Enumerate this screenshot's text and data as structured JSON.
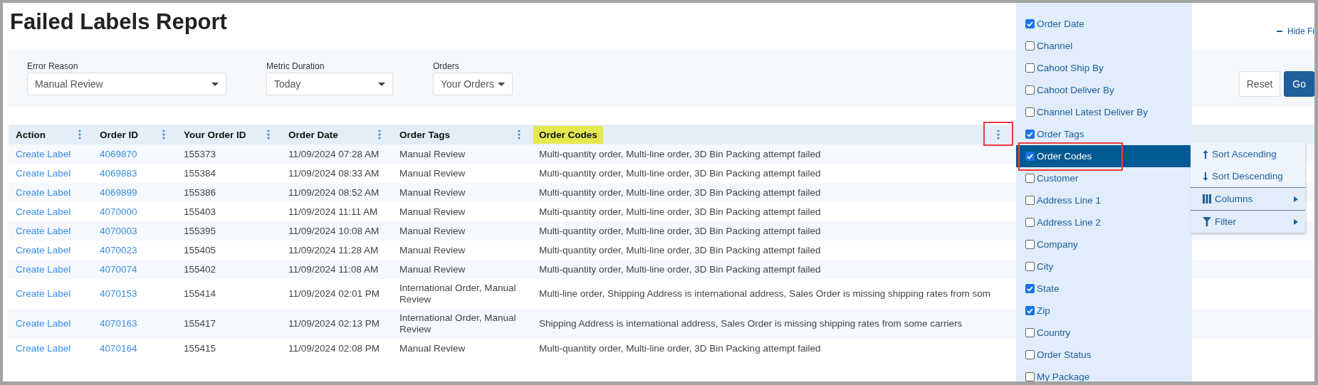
{
  "page": {
    "title": "Failed Labels Report",
    "hide_filters_link": "Hide Fi"
  },
  "filters": [
    {
      "label": "Error Reason",
      "value": "Manual Review"
    },
    {
      "label": "Metric Duration",
      "value": "Today"
    },
    {
      "label": "Orders",
      "value": "Your Orders"
    }
  ],
  "filter_buttons": [
    {
      "label": "Reset",
      "kind": "secondary"
    },
    {
      "label": "Go",
      "kind": "primary"
    }
  ],
  "table": {
    "columns": [
      {
        "label": "Action",
        "highlighted": false,
        "menu_outlined": false
      },
      {
        "label": "Order ID",
        "highlighted": false,
        "menu_outlined": false
      },
      {
        "label": "Your Order ID",
        "highlighted": false,
        "menu_outlined": false
      },
      {
        "label": "Order Date",
        "highlighted": false,
        "menu_outlined": false
      },
      {
        "label": "Order Tags",
        "highlighted": false,
        "menu_outlined": false
      },
      {
        "label": "Order Codes",
        "highlighted": true,
        "menu_outlined": true
      }
    ],
    "rows": [
      [
        "Create Label",
        "4069870",
        "155373",
        "11/09/2024 07:28 AM",
        "Manual Review",
        "Multi-quantity order, Multi-line order, 3D Bin Packing attempt failed"
      ],
      [
        "Create Label",
        "4069883",
        "155384",
        "11/09/2024 08:33 AM",
        "Manual Review",
        "Multi-quantity order, Multi-line order, 3D Bin Packing attempt failed"
      ],
      [
        "Create Label",
        "4069899",
        "155386",
        "11/09/2024 08:52 AM",
        "Manual Review",
        "Multi-quantity order, Multi-line order, 3D Bin Packing attempt failed"
      ],
      [
        "Create Label",
        "4070000",
        "155403",
        "11/09/2024 11:11 AM",
        "Manual Review",
        "Multi-quantity order, Multi-line order, 3D Bin Packing attempt failed"
      ],
      [
        "Create Label",
        "4070003",
        "155395",
        "11/09/2024 10:08 AM",
        "Manual Review",
        "Multi-quantity order, Multi-line order, 3D Bin Packing attempt failed"
      ],
      [
        "Create Label",
        "4070023",
        "155405",
        "11/09/2024 11:28 AM",
        "Manual Review",
        "Multi-quantity order, Multi-line order, 3D Bin Packing attempt failed"
      ],
      [
        "Create Label",
        "4070074",
        "155402",
        "11/09/2024 11:08 AM",
        "Manual Review",
        "Multi-quantity order, Multi-line order, 3D Bin Packing attempt failed"
      ],
      [
        "Create Label",
        "4070153",
        "155414",
        "11/09/2024 02:01 PM",
        "International Order, Manual Review",
        "Multi-line order, Shipping Address is international address, Sales Order is missing shipping rates from som"
      ],
      [
        "Create Label",
        "4070163",
        "155417",
        "11/09/2024 02:13 PM",
        "International Order, Manual Review",
        "Shipping Address is international address, Sales Order is missing shipping rates from some carriers"
      ],
      [
        "Create Label",
        "4070164",
        "155415",
        "11/09/2024 02:08 PM",
        "Manual Review",
        "Multi-quantity order, Multi-line order, 3D Bin Packing attempt failed"
      ]
    ]
  },
  "columns_menu": {
    "items": [
      {
        "label": "Order Date",
        "checked": true,
        "selected": false,
        "outlined": false
      },
      {
        "label": "Channel",
        "checked": false,
        "selected": false,
        "outlined": false
      },
      {
        "label": "Cahoot Ship By",
        "checked": false,
        "selected": false,
        "outlined": false
      },
      {
        "label": "Cahoot Deliver By",
        "checked": false,
        "selected": false,
        "outlined": false
      },
      {
        "label": "Channel Latest Deliver By",
        "checked": false,
        "selected": false,
        "outlined": false
      },
      {
        "label": "Order Tags",
        "checked": true,
        "selected": false,
        "outlined": false
      },
      {
        "label": "Order Codes",
        "checked": true,
        "selected": true,
        "outlined": true
      },
      {
        "label": "Customer",
        "checked": false,
        "selected": false,
        "outlined": false
      },
      {
        "label": "Address Line 1",
        "checked": false,
        "selected": false,
        "outlined": false
      },
      {
        "label": "Address Line 2",
        "checked": false,
        "selected": false,
        "outlined": false
      },
      {
        "label": "Company",
        "checked": false,
        "selected": false,
        "outlined": false
      },
      {
        "label": "City",
        "checked": false,
        "selected": false,
        "outlined": false
      },
      {
        "label": "State",
        "checked": true,
        "selected": false,
        "outlined": false
      },
      {
        "label": "Zip",
        "checked": true,
        "selected": false,
        "outlined": false
      },
      {
        "label": "Country",
        "checked": false,
        "selected": false,
        "outlined": false
      },
      {
        "label": "Order Status",
        "checked": false,
        "selected": false,
        "outlined": false
      },
      {
        "label": "My Package",
        "checked": false,
        "selected": false,
        "outlined": false
      }
    ]
  },
  "column_actions_menu": {
    "items": [
      {
        "label": "Sort Ascending",
        "kind": "ascending"
      },
      {
        "label": "Sort Descending",
        "kind": "descending"
      },
      {
        "label": "Columns",
        "kind": "columns"
      },
      {
        "label": "Filter",
        "kind": "filter"
      }
    ]
  }
}
